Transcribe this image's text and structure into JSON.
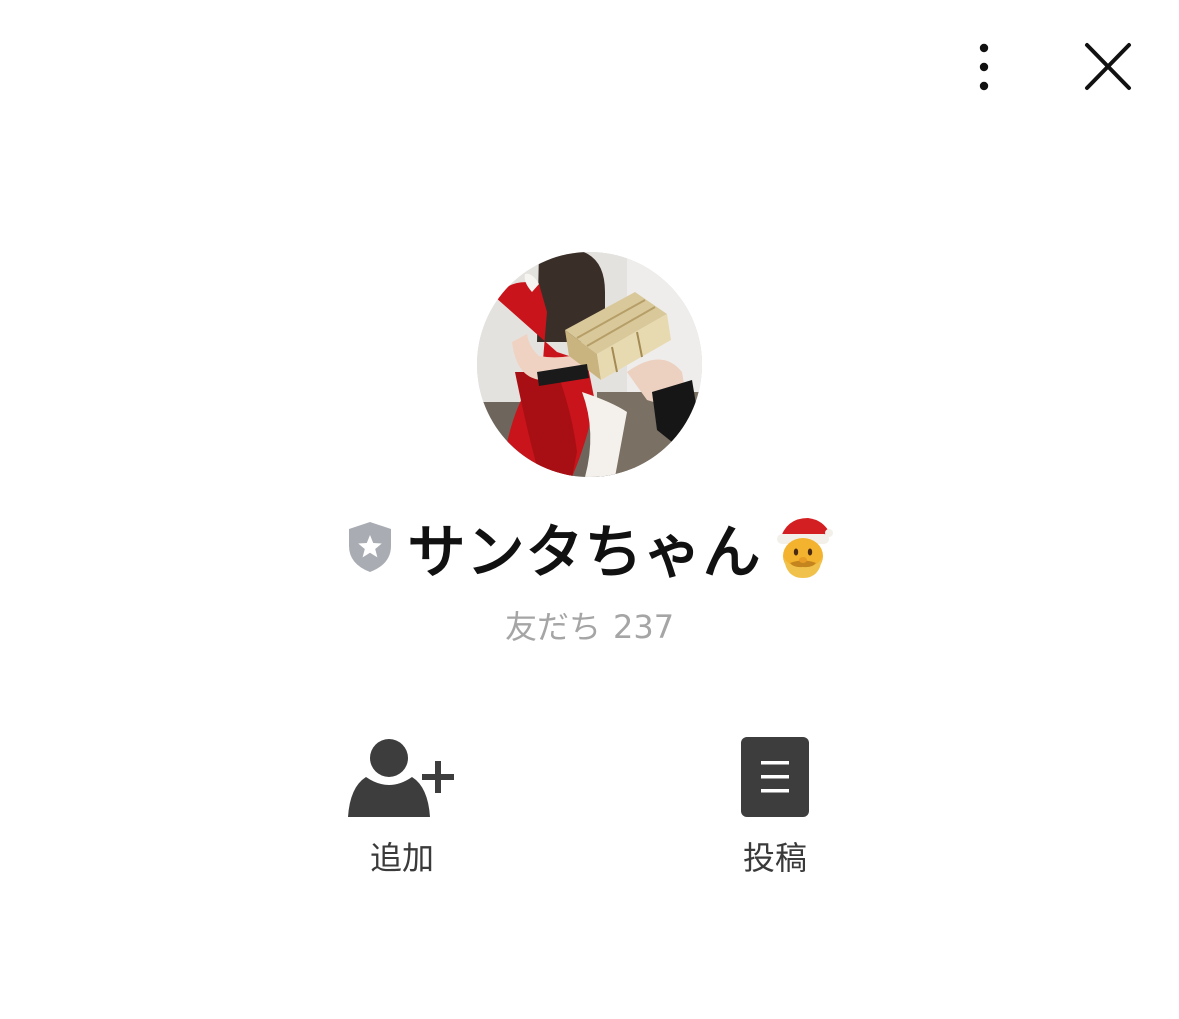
{
  "header": {
    "more_icon": "vertical-dots-icon",
    "close_icon": "close-icon"
  },
  "profile": {
    "name": "サンタちゃん",
    "badge_icon": "shield-star-icon",
    "name_emoji": "santa-emoji-icon",
    "friends_label": "友だち",
    "friends_count": "237"
  },
  "actions": {
    "add": {
      "label": "追加",
      "icon": "add-friend-icon"
    },
    "post": {
      "label": "投稿",
      "icon": "post-list-icon"
    }
  },
  "colors": {
    "icon_dark": "#3d3d3d",
    "badge_gray": "#a9adb3",
    "muted_text": "#a5a5a5"
  }
}
